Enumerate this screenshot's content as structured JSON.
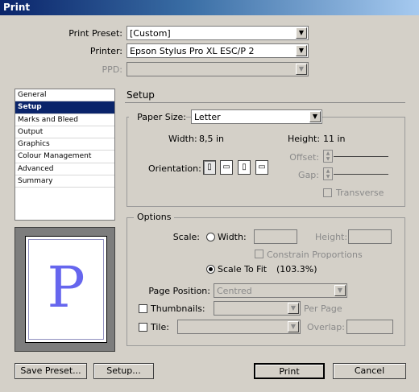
{
  "window": {
    "title": "Print"
  },
  "top": {
    "preset_label": "Print Preset:",
    "preset_value": "[Custom]",
    "printer_label": "Printer:",
    "printer_value": "Epson Stylus Pro XL ESC/P 2",
    "ppd_label": "PPD:",
    "ppd_value": ""
  },
  "sidebar": {
    "items": [
      {
        "label": "General"
      },
      {
        "label": "Setup"
      },
      {
        "label": "Marks and Bleed"
      },
      {
        "label": "Output"
      },
      {
        "label": "Graphics"
      },
      {
        "label": "Colour Management"
      },
      {
        "label": "Advanced"
      },
      {
        "label": "Summary"
      }
    ],
    "selected": "Setup"
  },
  "preview": {
    "glyph": "P"
  },
  "section_title": "Setup",
  "paper": {
    "label": "Paper Size:",
    "value": "Letter",
    "width_label": "Width:",
    "width_value": "8,5 in",
    "height_label": "Height:",
    "height_value": "11 in",
    "orientation_label": "Orientation:",
    "offset_label": "Offset:",
    "gap_label": "Gap:",
    "transverse_label": "Transverse"
  },
  "options": {
    "title": "Options",
    "scale_label": "Scale:",
    "width_radio_label": "Width:",
    "height_label": "Height:",
    "constrain_label": "Constrain Proportions",
    "scale_to_fit_label": "Scale To Fit",
    "scale_to_fit_value": "(103.3%)",
    "page_position_label": "Page Position:",
    "page_position_value": "Centred",
    "thumbnails_label": "Thumbnails:",
    "per_page_label": "Per Page",
    "tile_label": "Tile:",
    "overlap_label": "Overlap:"
  },
  "buttons": {
    "save_preset": "Save Preset...",
    "setup": "Setup...",
    "print": "Print",
    "cancel": "Cancel"
  }
}
